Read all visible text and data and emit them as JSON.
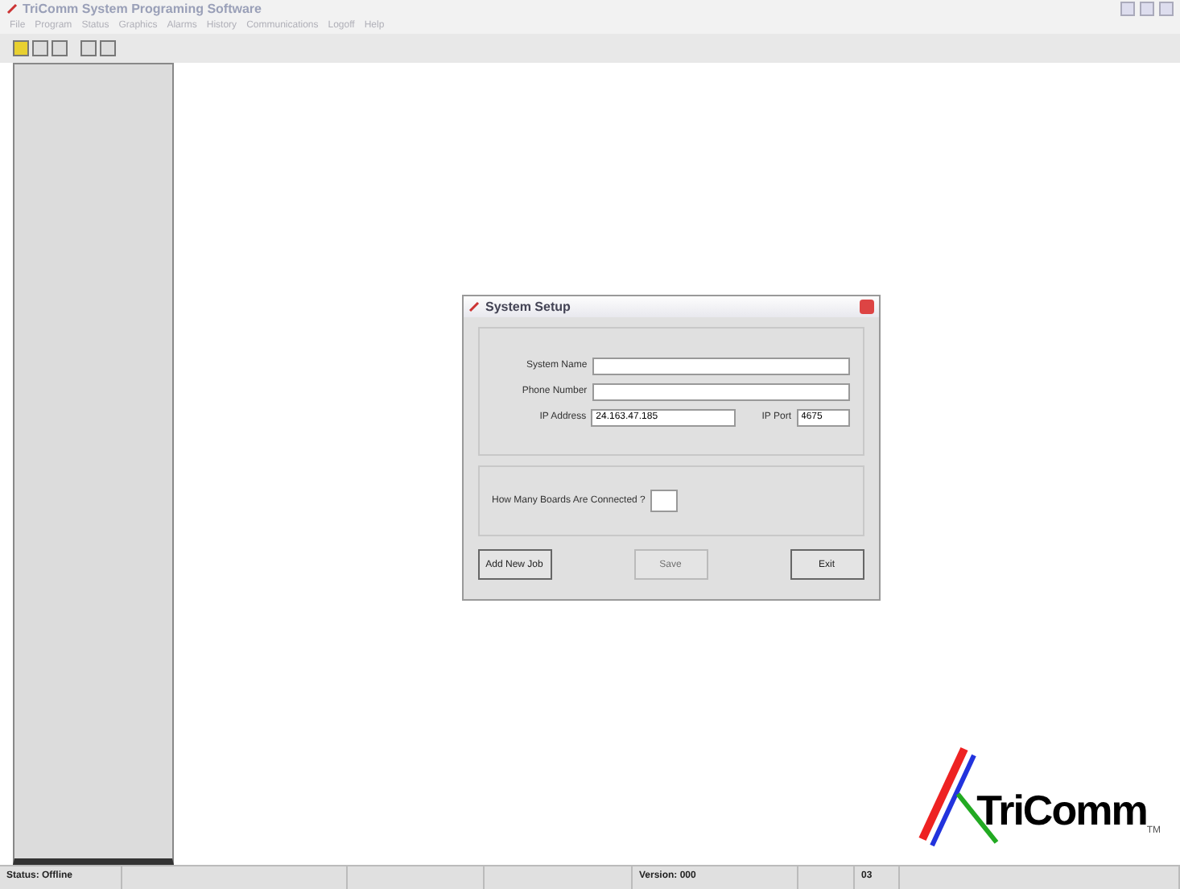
{
  "window": {
    "title": "TriComm System Programing Software"
  },
  "menu": [
    "File",
    "Program",
    "Status",
    "Graphics",
    "Alarms",
    "History",
    "Communications",
    "Logoff",
    "Help"
  ],
  "dialog": {
    "title": "System Setup",
    "fields": [
      {
        "label": "System Name"
      },
      {
        "label": "Phone Number"
      }
    ],
    "ip_address": {
      "label": "IP Address",
      "value": "24.163.47.185"
    },
    "ip_port": {
      "label": "IP Port",
      "value": "4675"
    },
    "boards": {
      "label": "How Many Boards Are Connected ?"
    },
    "buttons": [
      {
        "label": "Add New Job",
        "disabled": false
      },
      {
        "label": "Save",
        "disabled": true
      },
      {
        "label": "Exit",
        "disabled": false
      }
    ]
  },
  "logo": {
    "name": "TriComm",
    "mark": "TM"
  },
  "status_bar": [
    "Status: Offline",
    "Version: 000",
    "03"
  ]
}
